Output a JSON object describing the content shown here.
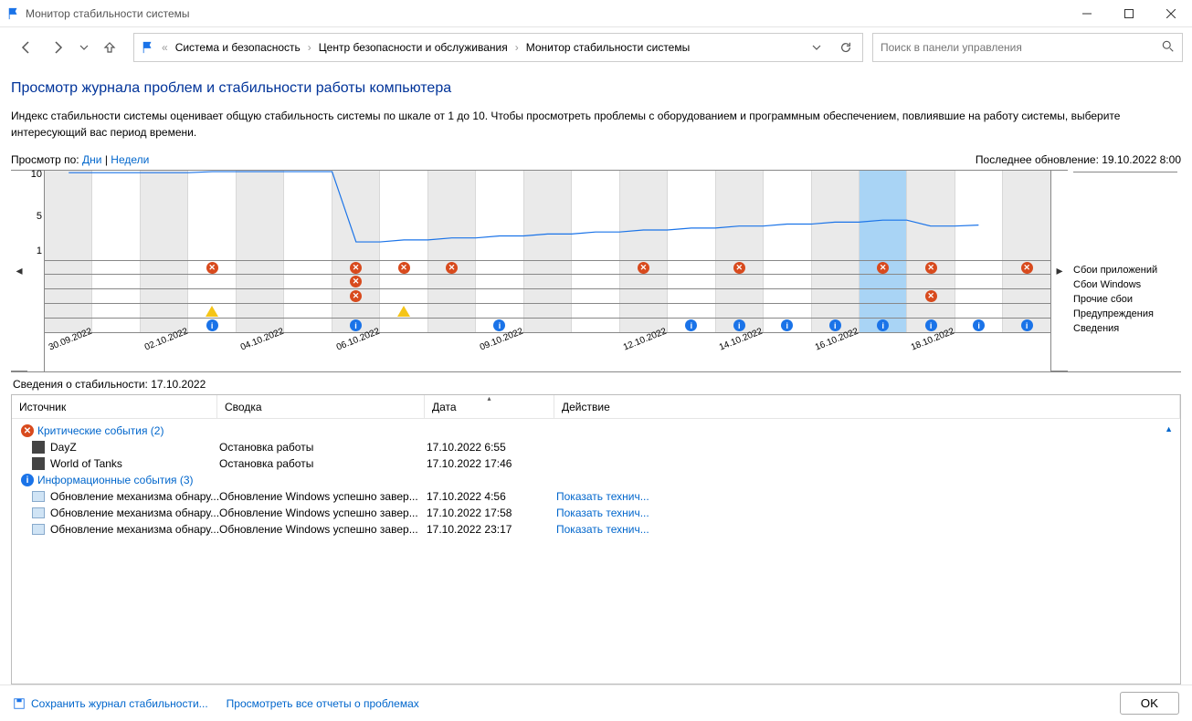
{
  "window": {
    "title": "Монитор стабильности системы"
  },
  "breadcrumb": {
    "items": [
      "Система и безопасность",
      "Центр безопасности и обслуживания",
      "Монитор стабильности системы"
    ]
  },
  "search": {
    "placeholder": "Поиск в панели управления"
  },
  "page": {
    "title": "Просмотр журнала проблем и стабильности работы компьютера",
    "description": "Индекс стабильности системы оценивает общую стабильность системы по шкале от 1 до 10. Чтобы просмотреть проблемы с оборудованием и программным обеспечением, повлиявшие на работу системы, выберите интересующий вас период времени."
  },
  "filter": {
    "label": "Просмотр по:",
    "days": "Дни",
    "sep": "|",
    "weeks": "Недели",
    "last_update": "Последнее обновление: 19.10.2022 8:00"
  },
  "legend": {
    "r0": "Сбои приложений",
    "r1": "Сбои Windows",
    "r2": "Прочие сбои",
    "r3": "Предупреждения",
    "r4": "Сведения"
  },
  "details": {
    "label": "Сведения о стабильности: 17.10.2022",
    "columns": {
      "source": "Источник",
      "summary": "Сводка",
      "date": "Дата",
      "action": "Действие"
    },
    "group_critical": "Критические события (2)",
    "group_info": "Информационные события (3)",
    "critical": [
      {
        "source": "DayZ",
        "summary": "Остановка работы",
        "date": "17.10.2022 6:55",
        "action": ""
      },
      {
        "source": "World of Tanks",
        "summary": "Остановка работы",
        "date": "17.10.2022 17:46",
        "action": ""
      }
    ],
    "info": [
      {
        "source": "Обновление механизма обнару...",
        "summary": "Обновление Windows успешно завер...",
        "date": "17.10.2022 4:56",
        "action": "Показать технич..."
      },
      {
        "source": "Обновление механизма обнару...",
        "summary": "Обновление Windows успешно завер...",
        "date": "17.10.2022 17:58",
        "action": "Показать технич..."
      },
      {
        "source": "Обновление механизма обнару...",
        "summary": "Обновление Windows успешно завер...",
        "date": "17.10.2022 23:17",
        "action": "Показать технич..."
      }
    ]
  },
  "footer": {
    "save": "Сохранить журнал стабильности...",
    "view_all": "Просмотреть все отчеты о проблемах",
    "ok": "OK"
  },
  "chart_data": {
    "type": "line",
    "ylabel": "",
    "xlabel": "",
    "ylim": [
      1,
      10
    ],
    "x_labels": [
      "30.09.2022",
      "",
      "02.10.2022",
      "",
      "04.10.2022",
      "",
      "06.10.2022",
      "",
      "",
      "09.10.2022",
      "",
      "",
      "12.10.2022",
      "",
      "14.10.2022",
      "",
      "16.10.2022",
      "",
      "18.10.2022",
      ""
    ],
    "y_ticks": [
      1,
      5,
      10
    ],
    "selected_index": 17,
    "stability_index": [
      9.8,
      9.8,
      9.8,
      9.9,
      9.9,
      9.9,
      2.8,
      3.0,
      3.2,
      3.4,
      3.6,
      3.8,
      4.0,
      4.2,
      4.4,
      4.6,
      4.8,
      5.0,
      4.4,
      4.5
    ],
    "events": {
      "app_failures": [
        0,
        0,
        0,
        1,
        0,
        0,
        1,
        1,
        1,
        0,
        0,
        0,
        1,
        0,
        1,
        0,
        0,
        1,
        1,
        0
      ],
      "windows_failures": [
        0,
        0,
        0,
        0,
        0,
        0,
        1,
        0,
        0,
        0,
        0,
        0,
        0,
        0,
        0,
        0,
        0,
        0,
        0,
        0
      ],
      "other_failures": [
        0,
        0,
        0,
        0,
        0,
        0,
        1,
        0,
        0,
        0,
        0,
        0,
        0,
        0,
        0,
        0,
        0,
        0,
        1,
        0
      ],
      "warnings": [
        0,
        0,
        0,
        1,
        0,
        0,
        0,
        1,
        0,
        0,
        0,
        0,
        0,
        0,
        0,
        0,
        0,
        0,
        0,
        0
      ],
      "info": [
        0,
        0,
        0,
        1,
        0,
        0,
        1,
        0,
        0,
        1,
        0,
        0,
        0,
        1,
        1,
        1,
        1,
        1,
        1,
        1
      ]
    },
    "extra_info_cols": [
      20
    ],
    "extra_err_cols": [
      20
    ]
  }
}
